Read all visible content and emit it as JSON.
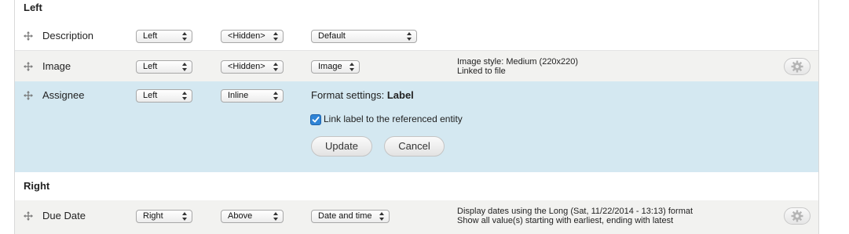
{
  "regions": {
    "left": {
      "title": "Left"
    },
    "right": {
      "title": "Right"
    }
  },
  "rows": [
    {
      "label": "Description",
      "region": "Left",
      "label_display": "<Hidden>",
      "formatter": "Default",
      "summary": []
    },
    {
      "label": "Image",
      "region": "Left",
      "label_display": "<Hidden>",
      "formatter": "Image",
      "summary": [
        "Image style: Medium (220x220)",
        "Linked to file"
      ]
    },
    {
      "label": "Assignee",
      "region": "Left",
      "label_display": "Inline",
      "formatter": "",
      "summary": []
    },
    {
      "label": "Due Date",
      "region": "Right",
      "label_display": "Above",
      "formatter": "Date and time",
      "summary": [
        "Display dates using the Long (Sat, 11/22/2014 - 13:13) format",
        "Show all value(s) starting with earliest, ending with latest"
      ]
    }
  ],
  "format_settings": {
    "prefix": "Format settings:",
    "formatter_name": "Label",
    "checkbox_label": "Link label to the referenced entity",
    "checkbox_checked": true,
    "update_label": "Update",
    "cancel_label": "Cancel"
  },
  "icons": {
    "drag": "move-cross-icon",
    "settings": "gear-icon",
    "select_arrows": "select-updown-arrows-icon"
  },
  "colors": {
    "row_alt_bg": "#f2f2f0",
    "edit_row_bg": "#d4e8f1",
    "checkbox_blue": "#2f84d6"
  }
}
